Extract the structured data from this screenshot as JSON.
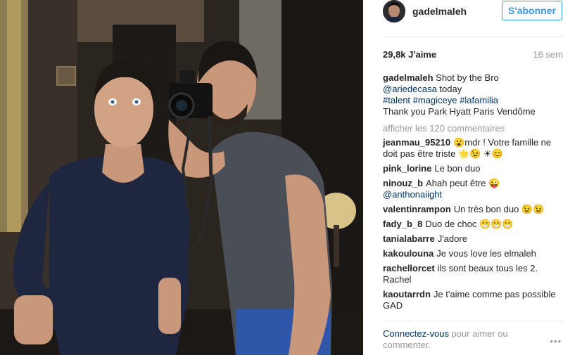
{
  "post": {
    "username": "gadelmaleh",
    "follow_label": "S'abonner",
    "likes": "29,8k J'aime",
    "time_ago": "16 sem",
    "caption": {
      "username": "gadelmaleh",
      "text": "Shot by the Bro",
      "mention": "@ariedecasa",
      "mention_suffix": "today",
      "hashtags": "#talent #magiceye #lafamilia",
      "thanks": "Thank you Park Hyatt Paris Vendôme"
    },
    "view_comments": "afficher les 120 commentaires"
  },
  "comments": [
    {
      "user": "jeanmau_95210",
      "text": "😮mdr ! Votre famille ne doit pas être triste 🌟😉 ☀😊"
    },
    {
      "user": "pink_lorine",
      "text": "Le bon duo"
    },
    {
      "user": "ninouz_b",
      "text": "Ahah peut être 😜",
      "mention": "@anthonaiight"
    },
    {
      "user": "valentinrampon",
      "text": "Un très bon duo 😉😉"
    },
    {
      "user": "fady_b_8",
      "text": "Duo de choc 😁😁😁"
    },
    {
      "user": "tanialabarre",
      "text": "J'adore"
    },
    {
      "user": "kakoulouna",
      "text": "Je vous love les elmaleh"
    },
    {
      "user": "rachellorcet",
      "text": "ils sont beaux tous les 2. Rachel"
    },
    {
      "user": "kaoutarrdn",
      "text": "Je t'aime comme pas possible GAD"
    }
  ],
  "footer": {
    "login_link": "Connectez-vous",
    "login_suffix": "pour aimer ou commenter.",
    "more_icon": "more-options-icon"
  },
  "colors": {
    "accent": "#3897f0",
    "link": "#003569",
    "muted": "#999999"
  }
}
